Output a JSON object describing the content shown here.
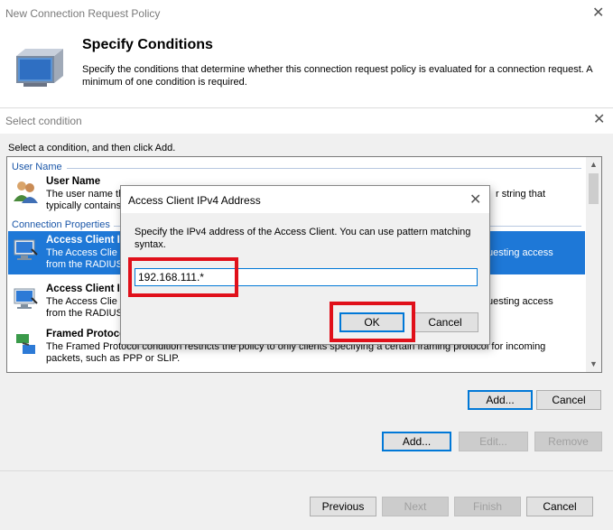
{
  "outer": {
    "title": "New Connection Request Policy",
    "header_title": "Specify Conditions",
    "header_desc": "Specify the conditions that determine whether this connection request policy is evaluated for a connection request. A minimum of one condition is required."
  },
  "select_dialog": {
    "title": "Select condition",
    "instruction": "Select a condition, and then click Add.",
    "groups": [
      "User Name",
      "Connection Properties"
    ],
    "conditions": [
      {
        "name": "User Name",
        "desc": "The user name th",
        "desc_tail": "r string that",
        "desc2": "typically contains"
      },
      {
        "name": "Access Client I",
        "desc": "The Access Clie",
        "desc_tail": "uesting access",
        "desc2": "from the RADIUS"
      },
      {
        "name": "Access Client I",
        "desc": "The Access Clie",
        "desc_tail": "uesting access",
        "desc2": "from the RADIUS"
      },
      {
        "name": "Framed Protoco",
        "desc": "The Framed Protocol condition restricts the policy to only clients specifying a certain framing protocol for incoming",
        "desc2": "packets, such as PPP or SLIP."
      }
    ],
    "add_label": "Add...",
    "cancel_label": "Cancel"
  },
  "ip_dialog": {
    "title": "Access Client IPv4 Address",
    "desc": "Specify the IPv4 address of the Access Client. You can use pattern matching syntax.",
    "value": "192.168.111.*",
    "ok_label": "OK",
    "cancel_label": "Cancel"
  },
  "conditions_panel": {
    "add_label": "Add...",
    "edit_label": "Edit...",
    "remove_label": "Remove"
  },
  "wizard_nav": {
    "previous": "Previous",
    "next": "Next",
    "finish": "Finish",
    "cancel": "Cancel"
  },
  "colors": {
    "selection": "#1e78d7",
    "highlight": "#e0101a",
    "group_text": "#1a56a8"
  }
}
